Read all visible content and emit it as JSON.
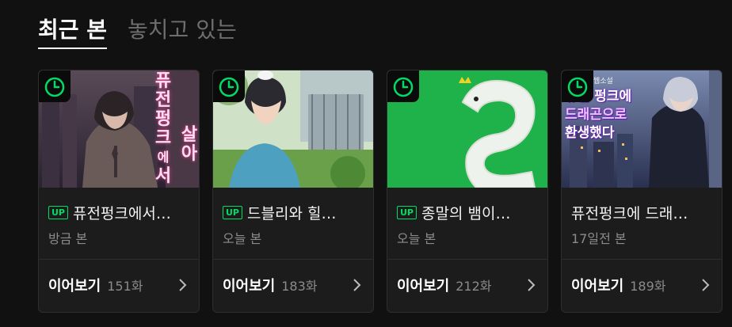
{
  "tabs": [
    {
      "label": "최근 본",
      "active": true
    },
    {
      "label": "놓치고 있는",
      "active": false
    }
  ],
  "colors": {
    "accent": "#00dc64",
    "background": "#111111"
  },
  "cards": [
    {
      "badge": "UP",
      "title": "퓨전펑크에서…",
      "cover_text": [
        "퓨",
        "전",
        "펑",
        "크",
        "에",
        "서",
        "살",
        "아"
      ],
      "viewed": "방금 본",
      "continue_label": "이어보기",
      "episode": "151화"
    },
    {
      "badge": "UP",
      "title": "드블리와 힐…",
      "viewed": "오늘 본",
      "continue_label": "이어보기",
      "episode": "183화"
    },
    {
      "badge": "UP",
      "title": "종말의 뱀이…",
      "viewed": "오늘 본",
      "continue_label": "이어보기",
      "episode": "212화"
    },
    {
      "badge": "",
      "title": "퓨전펑크에 드래…",
      "cover_text": [
        "퓨전 펑크에",
        "드래곤으로",
        "환생했다"
      ],
      "cover_tag": "웹소설",
      "viewed": "17일전 본",
      "continue_label": "이어보기",
      "episode": "189화"
    }
  ],
  "icons": {
    "timer": "clock-icon",
    "arrow": "chevron-right-icon"
  }
}
